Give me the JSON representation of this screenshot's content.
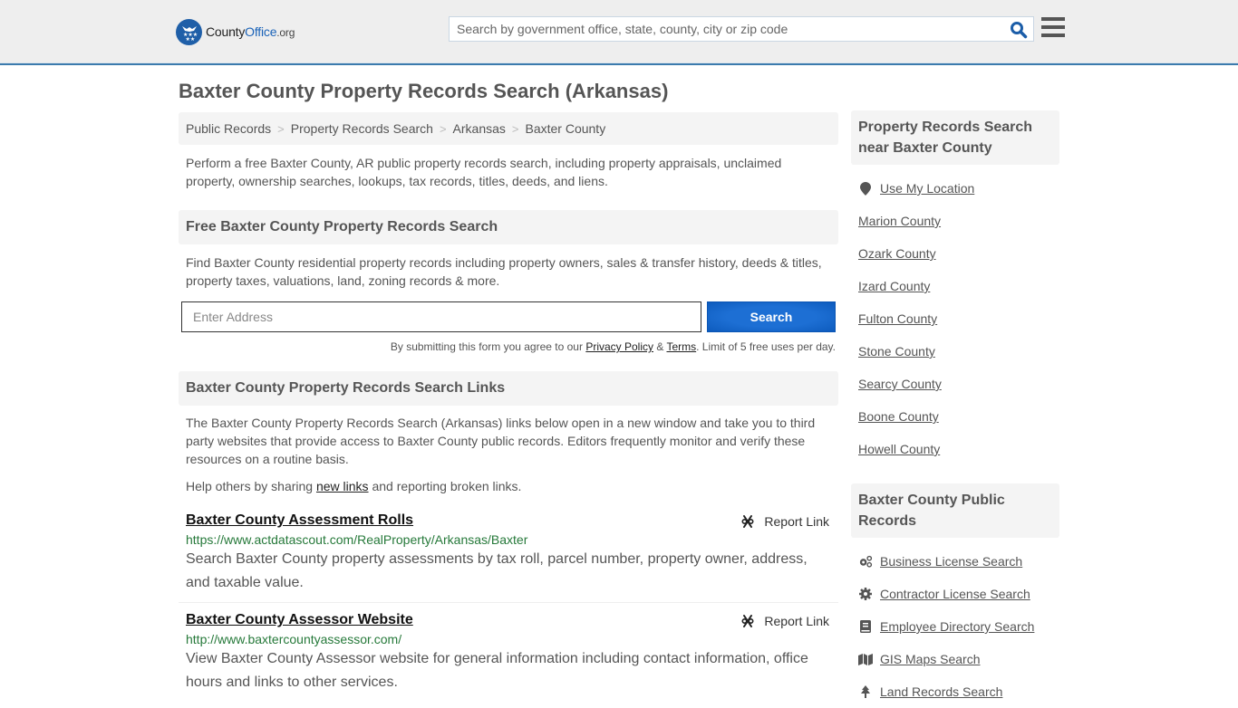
{
  "header": {
    "logo": {
      "part1": "County",
      "part2": "Office",
      "part3": ".org"
    },
    "search_placeholder": "Search by government office, state, county, city or zip code"
  },
  "page_title": "Baxter County Property Records Search (Arkansas)",
  "breadcrumb": [
    "Public Records",
    "Property Records Search",
    "Arkansas",
    "Baxter County"
  ],
  "intro": "Perform a free Baxter County, AR public property records search, including property appraisals, unclaimed property, ownership searches, lookups, tax records, titles, deeds, and liens.",
  "free_search": {
    "heading": "Free Baxter County Property Records Search",
    "description": "Find Baxter County residential property records including property owners, sales & transfer history, deeds & titles, property taxes, valuations, land, zoning records & more.",
    "address_placeholder": "Enter Address",
    "button_label": "Search",
    "disclaimer_prefix": "By submitting this form you agree to our ",
    "privacy_label": "Privacy Policy",
    "amp": " & ",
    "terms_label": "Terms",
    "disclaimer_suffix": ". Limit of 5 free uses per day."
  },
  "links_section": {
    "heading": "Baxter County Property Records Search Links",
    "description": "The Baxter County Property Records Search (Arkansas) links below open in a new window and take you to third party websites that provide access to Baxter County public records. Editors frequently monitor and verify these resources on a routine basis.",
    "help_prefix": "Help others by sharing ",
    "help_link": "new links",
    "help_suffix": " and reporting broken links.",
    "report_label": "Report Link",
    "items": [
      {
        "title": "Baxter County Assessment Rolls",
        "url": "https://www.actdatascout.com/RealProperty/Arkansas/Baxter",
        "description": "Search Baxter County property assessments by tax roll, parcel number, property owner, address, and taxable value."
      },
      {
        "title": "Baxter County Assessor Website",
        "url": "http://www.baxtercountyassessor.com/",
        "description": "View Baxter County Assessor website for general information including contact information, office hours and links to other services."
      }
    ]
  },
  "sidebar": {
    "nearby_heading": "Property Records Search near Baxter County",
    "use_location": "Use My Location",
    "nearby": [
      "Marion County",
      "Ozark County",
      "Izard County",
      "Fulton County",
      "Stone County",
      "Searcy County",
      "Boone County",
      "Howell County"
    ],
    "public_heading": "Baxter County Public Records",
    "public_records": [
      {
        "label": "Business License Search",
        "icon": "cogs-icon"
      },
      {
        "label": "Contractor License Search",
        "icon": "gear-icon"
      },
      {
        "label": "Employee Directory Search",
        "icon": "book-icon"
      },
      {
        "label": "GIS Maps Search",
        "icon": "map-icon"
      },
      {
        "label": "Land Records Search",
        "icon": "tree-icon"
      }
    ]
  },
  "colors": {
    "accent": "#1b63b8",
    "button": "#1d6fd4",
    "url_green": "#26793a",
    "header_border": "#3b7bad"
  }
}
